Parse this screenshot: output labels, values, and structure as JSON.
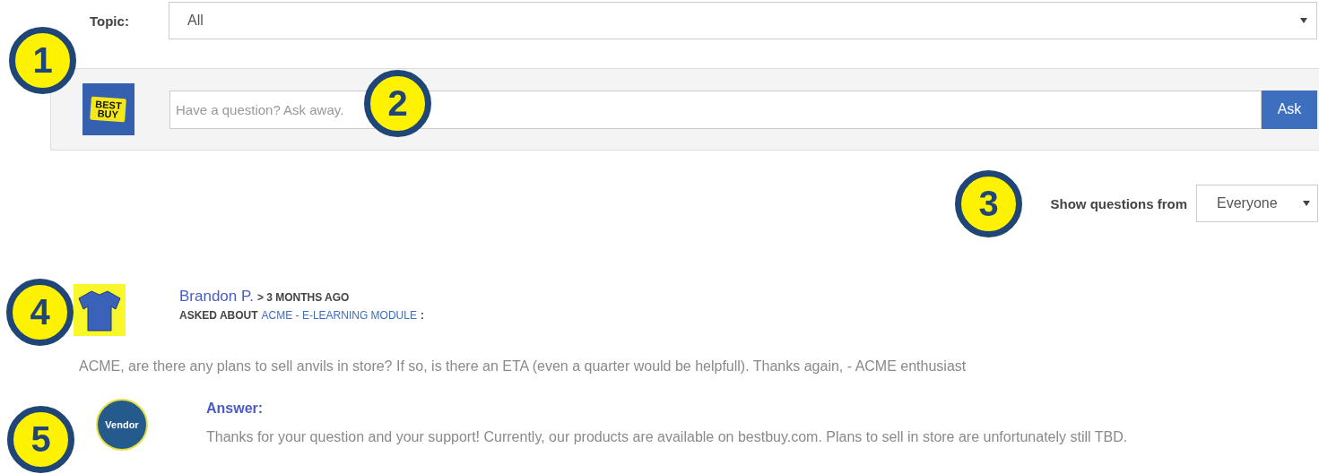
{
  "topic_filter": {
    "label": "Topic:",
    "value": "All"
  },
  "ask_box": {
    "logo": [
      "BEST",
      "BUY"
    ],
    "placeholder": "Have a question? Ask away.",
    "button": "Ask"
  },
  "show_filter": {
    "label": "Show questions from",
    "value": "Everyone"
  },
  "question": {
    "author": "Brandon P.",
    "time": "> 3 MONTHS AGO",
    "asked_about_label": "ASKED ABOUT",
    "topic": "ACME - E-LEARNING MODULE",
    "topic_suffix": ":",
    "text": "ACME, are there any plans to sell anvils in store? If so, is there an ETA (even a quarter would be helpfull). Thanks again, - ACME enthusiast"
  },
  "answer": {
    "avatar_label": "Vendor",
    "heading": "Answer:",
    "text": "Thanks for your question and your support! Currently, our products are available on bestbuy.com. Plans to sell in store are unfortunately still TBD."
  },
  "callouts": [
    "1",
    "2",
    "3",
    "4",
    "5"
  ]
}
